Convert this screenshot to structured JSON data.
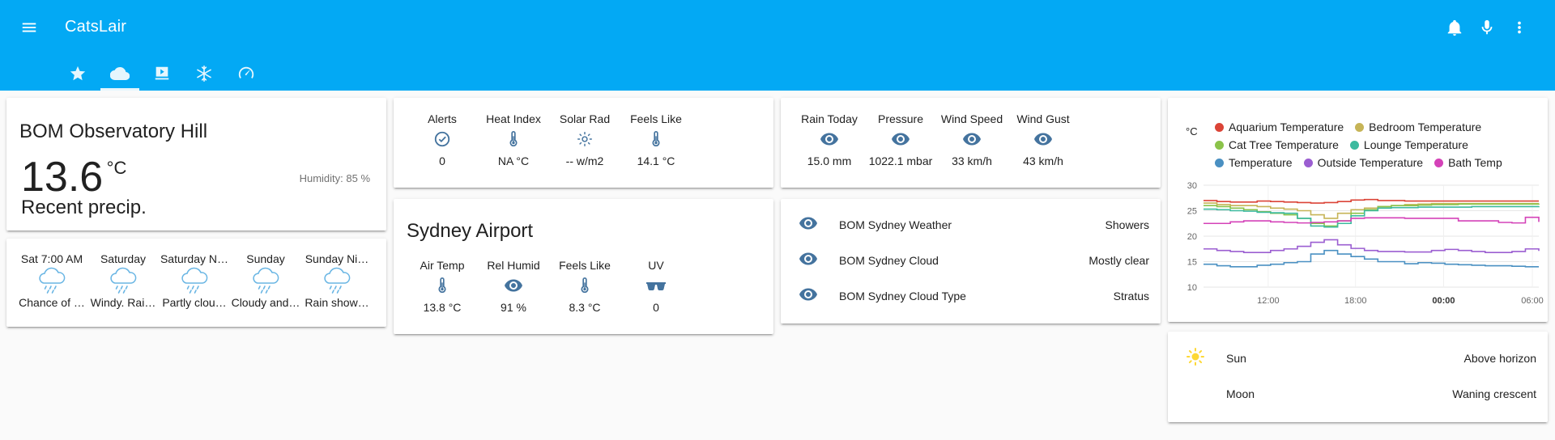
{
  "app": {
    "title": "CatsLair"
  },
  "tabs": [
    {
      "name": "tab-favorites",
      "icon": "star-icon"
    },
    {
      "name": "tab-weather",
      "icon": "cloud-icon"
    },
    {
      "name": "tab-media",
      "icon": "media-icon"
    },
    {
      "name": "tab-climate",
      "icon": "snowflake-icon"
    },
    {
      "name": "tab-gauges",
      "icon": "speedometer-icon"
    }
  ],
  "observatory": {
    "name": "BOM Observatory Hill",
    "temperature": "13.6",
    "unit": "°C",
    "condition": "Recent precip.",
    "humidity": "Humidity: 85 %"
  },
  "forecast": [
    {
      "day": "Sat 7:00 AM",
      "condition": "Chance of …"
    },
    {
      "day": "Saturday",
      "condition": "Windy. Rai…"
    },
    {
      "day": "Saturday N…",
      "condition": "Partly clou…"
    },
    {
      "day": "Sunday",
      "condition": "Cloudy and…"
    },
    {
      "day": "Sunday Ni…",
      "condition": "Rain show…"
    }
  ],
  "glance1": [
    {
      "label": "Alerts",
      "value": "0",
      "icon": "check-circle-icon"
    },
    {
      "label": "Heat Index",
      "value": "NA °C",
      "icon": "thermometer-icon"
    },
    {
      "label": "Solar Rad",
      "value": "-- w/m2",
      "icon": "brightness-icon"
    },
    {
      "label": "Feels Like",
      "value": "14.1 °C",
      "icon": "thermometer-icon"
    }
  ],
  "airport": {
    "title": "Sydney Airport",
    "items": [
      {
        "label": "Air Temp",
        "value": "13.8 °C",
        "icon": "thermometer-icon"
      },
      {
        "label": "Rel Humid",
        "value": "91 %",
        "icon": "eye-icon"
      },
      {
        "label": "Feels Like",
        "value": "8.3 °C",
        "icon": "thermometer-icon"
      },
      {
        "label": "UV",
        "value": "0",
        "icon": "sunglasses-icon"
      }
    ]
  },
  "glance2": [
    {
      "label": "Rain Today",
      "value": "15.0 mm",
      "icon": "eye-icon"
    },
    {
      "label": "Pressure",
      "value": "1022.1 mbar",
      "icon": "eye-icon"
    },
    {
      "label": "Wind Speed",
      "value": "33 km/h",
      "icon": "eye-icon"
    },
    {
      "label": "Wind Gust",
      "value": "43 km/h",
      "icon": "eye-icon"
    }
  ],
  "bom_sydney": [
    {
      "name": "BOM Sydney Weather",
      "state": "Showers",
      "icon": "eye-icon"
    },
    {
      "name": "BOM Sydney Cloud",
      "state": "Mostly clear",
      "icon": "eye-icon"
    },
    {
      "name": "BOM Sydney Cloud Type",
      "state": "Stratus",
      "icon": "eye-icon"
    }
  ],
  "sun_moon": [
    {
      "name": "Sun",
      "state": "Above horizon",
      "icon": "sun-icon",
      "color": "#fdd835"
    },
    {
      "name": "Moon",
      "state": "Waning crescent",
      "icon": "moon-icon",
      "color": "#44739e"
    }
  ],
  "colors": {
    "primary": "#03a9f4",
    "icon": "#44739e"
  },
  "chart_data": {
    "type": "line",
    "ylabel": "°C",
    "ylim": [
      10,
      30
    ],
    "yticks": [
      "10",
      "15",
      "20",
      "25",
      "30"
    ],
    "xticks": [
      "12:00",
      "18:00",
      "00:00",
      "06:00"
    ],
    "xticks_bold": [
      false,
      false,
      true,
      false
    ],
    "x": [
      0,
      1,
      2,
      3,
      4,
      5,
      6,
      7,
      8,
      9,
      10,
      11,
      12,
      13,
      14,
      15,
      16,
      17,
      18,
      19,
      20,
      21,
      22,
      23,
      24,
      25
    ],
    "series": [
      {
        "name": "Aquarium Temperature",
        "color": "#db4437",
        "values": [
          27,
          26.8,
          26.7,
          26.7,
          26.9,
          26.8,
          26.7,
          26.6,
          26.5,
          26.6,
          26.8,
          27.1,
          27.2,
          27.0,
          27.0,
          26.9,
          26.9,
          26.9,
          26.9,
          26.9,
          26.9,
          26.9,
          26.9,
          26.9,
          26.9,
          26.9
        ]
      },
      {
        "name": "Bedroom Temperature",
        "color": "#c6b457",
        "values": [
          26.5,
          26.2,
          26,
          26,
          25.8,
          25.5,
          25.3,
          25,
          24.2,
          23.5,
          24.5,
          25.2,
          25.5,
          25.8,
          26,
          26.2,
          26.3,
          26.4,
          26.4,
          26.4,
          26.4,
          26.4,
          26.4,
          26.4,
          26.4,
          26.4
        ]
      },
      {
        "name": "Cat Tree Temperature",
        "color": "#8bc34a",
        "values": [
          26,
          25.8,
          25.5,
          25.2,
          24.8,
          24.5,
          24.2,
          23.5,
          22.5,
          22,
          23,
          24.5,
          25.2,
          25.8,
          26,
          26,
          26.1,
          26.2,
          26.2,
          26.3,
          26.3,
          26.3,
          26.3,
          26.3,
          26.3,
          26.4
        ]
      },
      {
        "name": "Lounge Temperature",
        "color": "#3cba9f",
        "values": [
          25.3,
          25.2,
          25,
          24.9,
          24.7,
          24.6,
          24.5,
          23.5,
          22,
          21.8,
          22.5,
          24,
          25,
          25.5,
          25.6,
          25.6,
          25.7,
          25.7,
          25.7,
          25.7,
          25.8,
          25.8,
          25.8,
          25.8,
          25.8,
          25.9
        ]
      },
      {
        "name": "Temperature",
        "color": "#4a90c2",
        "values": [
          14.5,
          14.2,
          14,
          14,
          14.3,
          14.5,
          14.8,
          15,
          16.5,
          17.2,
          16.5,
          16,
          15.5,
          15,
          15,
          14.6,
          14.8,
          14.7,
          14.5,
          14.4,
          14.3,
          14.2,
          14.2,
          14.1,
          14,
          14
        ]
      },
      {
        "name": "Outside Temperature",
        "color": "#9b5ed1",
        "values": [
          17.5,
          17.2,
          17,
          16.8,
          16.8,
          17.2,
          17.5,
          18,
          18.8,
          19.3,
          18.3,
          17.6,
          17.2,
          17,
          17,
          16.9,
          16.9,
          17.2,
          17.4,
          17.2,
          17,
          16.8,
          16.8,
          17,
          17.5,
          17.1
        ]
      },
      {
        "name": "Bath Temp",
        "color": "#d442b8",
        "values": [
          22.5,
          22.5,
          22.8,
          23,
          23,
          22.8,
          22.7,
          22.6,
          22.7,
          22.8,
          23,
          23.5,
          23.6,
          23.6,
          23.6,
          23.5,
          23.5,
          23.5,
          23.5,
          23,
          23,
          23,
          22.7,
          22.6,
          23.7,
          22.8
        ]
      }
    ]
  }
}
